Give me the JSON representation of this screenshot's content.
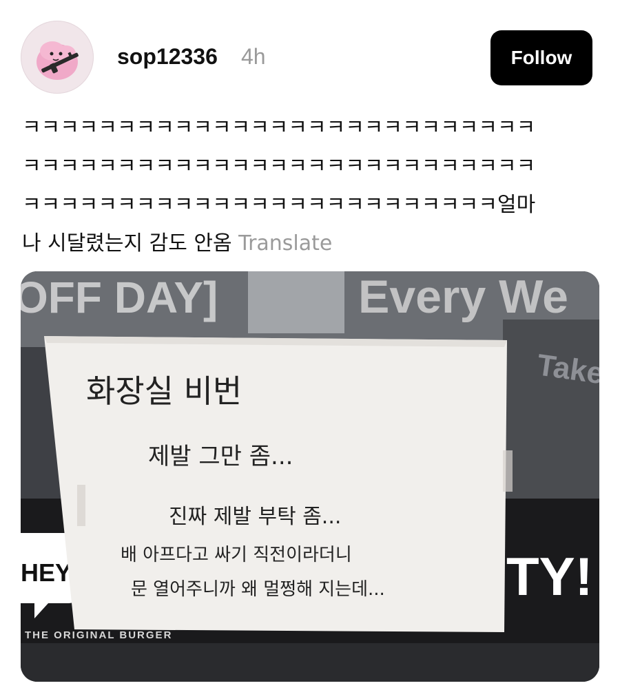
{
  "post": {
    "username": "sop12336",
    "time_ago": "4h",
    "follow_label": "Follow",
    "text_lines": [
      "ㅋㅋㅋㅋㅋㅋㅋㅋㅋㅋㅋㅋㅋㅋㅋㅋㅋㅋㅋㅋㅋㅋㅋㅋㅋㅋㅋ",
      "ㅋㅋㅋㅋㅋㅋㅋㅋㅋㅋㅋㅋㅋㅋㅋㅋㅋㅋㅋㅋㅋㅋㅋㅋㅋㅋㅋ",
      "ㅋㅋㅋㅋㅋㅋㅋㅋㅋㅋㅋㅋㅋㅋㅋㅋㅋㅋㅋㅋㅋㅋㅋㅋㅋ얼마",
      "나 시달렸는지 감도 안옴"
    ],
    "translate_label": "Translate"
  },
  "photo": {
    "store_banner": {
      "left_text": "OFF DAY]",
      "right_text": "Every We",
      "side_text": "Take",
      "hey_text": "HEY,",
      "ty_text": "TY!",
      "tagline": "THE ORIGINAL BURGER"
    },
    "note_lines": [
      "화장실 비번",
      "제발 그만 좀...",
      "진짜 제발 부탁 좀...",
      "배 아프다고 싸기 직전이라더니",
      "문 열어주니까 왜 멀쩡해 지는데..."
    ]
  },
  "icons": {
    "avatar": "pink-blob-with-rifle-avatar-icon"
  },
  "colors": {
    "follow_bg": "#000000",
    "muted_text": "#9a9a9a",
    "paper": "#f1efec"
  }
}
